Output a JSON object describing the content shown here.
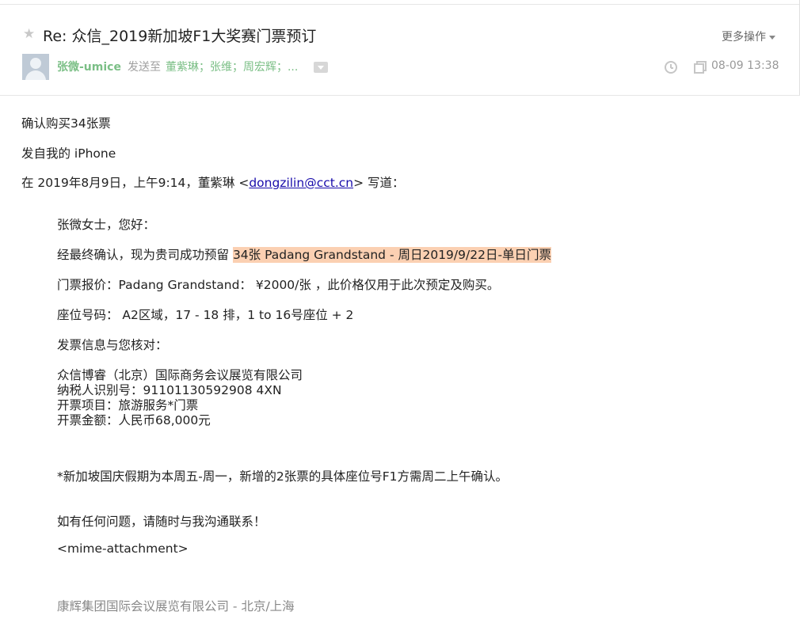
{
  "header": {
    "star_icon": "★",
    "subject": "Re: 众信_2019新加坡F1大奖赛门票预订",
    "more_actions": "更多操作",
    "sender_name": "张微-umice",
    "sent_to_label": "发送至",
    "recipients": "董紫琳；张维；周宏辉；...",
    "datetime": "08-09 13:38"
  },
  "body": {
    "line1": "确认购买34张票",
    "line2": "发自我的 iPhone",
    "quote_prefix": "在 2019年8月9日，上午9:14，董紫琳 <",
    "quote_email": "dongzilin@cct.cn",
    "quote_suffix": "> 写道：",
    "greeting": "张微女士，您好：",
    "confirm_prefix": "经最终确认，现为贵司成功预留 ",
    "confirm_highlight": "34张 Padang Grandstand - 周日2019/9/22日-单日门票",
    "price": "门票报价：Padang Grandstand： ¥2000/张 ，此价格仅用于此次预定及购买。",
    "seat": "座位号码： A2区域，17 - 18 排，1 to 16号座位 + 2",
    "invoice_check": "发票信息与您核对：",
    "company": "众信博睿（北京）国际商务会议展览有限公司",
    "tax_id": "纳税人识别号：91101130592908 4XN",
    "invoice_item": "开票项目：旅游服务*门票",
    "invoice_amount": "开票金额：人民币68,000元",
    "note": "*新加坡国庆假期为本周五-周一，新增的2张票的具体座位号F1方需周二上午确认。",
    "contact": "如有任何问题，请随时与我沟通联系！",
    "attachment": "<mime-attachment>",
    "signature": "康辉集团国际会议展览有限公司 - 北京/上海"
  },
  "colors": {
    "sender_green": "#7bbf86",
    "highlight": "#fbd0b2",
    "link": "#1a0dab"
  }
}
